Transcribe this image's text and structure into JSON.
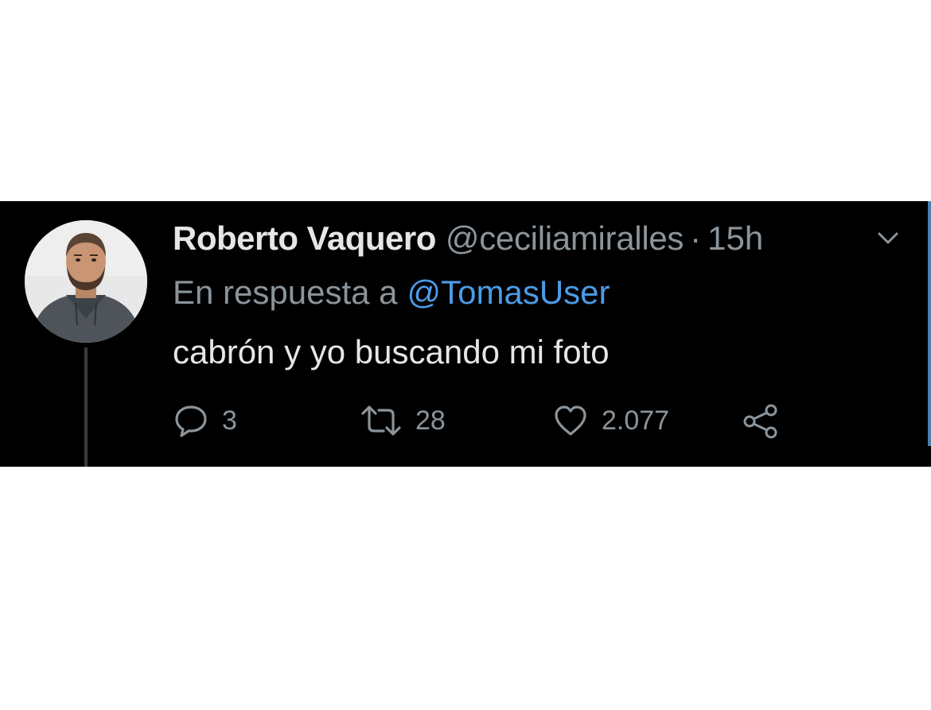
{
  "tweet": {
    "author": {
      "display_name": "Roberto Vaquero",
      "handle": "@ceciliamiralles"
    },
    "separator": "·",
    "time": "15h",
    "reply_context": {
      "prefix": "En respuesta a",
      "mention": "@TomasUser"
    },
    "text": "cabrón y yo buscando mi foto",
    "actions": {
      "reply_count": "3",
      "retweet_count": "28",
      "like_count": "2.077"
    }
  },
  "colors": {
    "background": "#000000",
    "name_text": "#e6e6e6",
    "secondary_text": "#8b949b",
    "mention_blue": "#4c9be8"
  },
  "icons": {
    "menu": "chevron-down-icon",
    "reply": "speech-bubble-icon",
    "retweet": "retweet-arrows-icon",
    "like": "heart-icon",
    "share": "share-nodes-icon"
  }
}
